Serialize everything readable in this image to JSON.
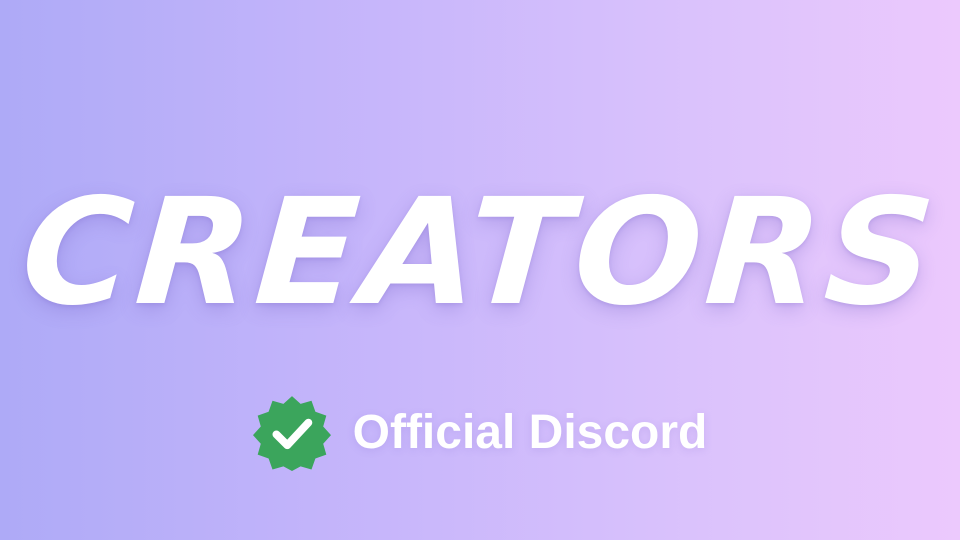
{
  "banner": {
    "headline": "CREATORS",
    "badge_icon": "verified-check-badge-icon",
    "badge_color": "#3ba55c",
    "subline": "Official Discord"
  },
  "colors": {
    "gradient_start": "#aeaaf7",
    "gradient_end": "#ecc9fd",
    "text": "#ffffff"
  }
}
